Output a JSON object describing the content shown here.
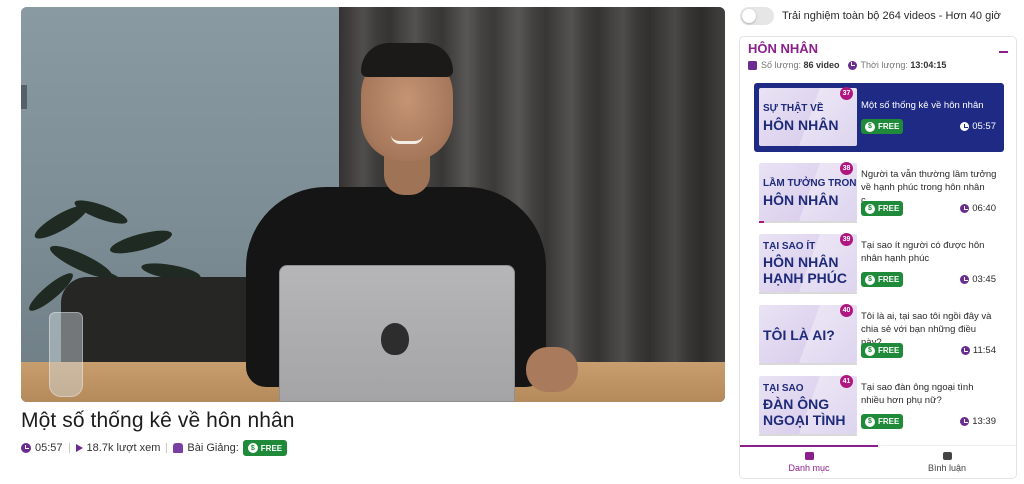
{
  "video": {
    "title": "Một số thống kê về hôn nhân",
    "duration": "05:57",
    "views": "18.7k lượt xem",
    "type_label": "Bài Giảng:",
    "badge": "FREE"
  },
  "trial_toggle": {
    "label": "Trải nghiệm toàn bộ 264 videos - Hơn 40 giờ",
    "enabled": false
  },
  "playlist": {
    "title": "HÔN NHÂN",
    "count_label": "Số lượng:",
    "count_value": "86 video",
    "time_label": "Thời lượng:",
    "time_value": "13:04:15",
    "items": [
      {
        "number": "37",
        "thumb_line1": "SỰ THẬT VỀ",
        "thumb_line2": "HÔN NHÂN",
        "thumb_line3": "",
        "title": "Một số thống kê về hôn nhân",
        "badge": "FREE",
        "duration": "05:57",
        "active": true,
        "progress": 1.0
      },
      {
        "number": "38",
        "thumb_line1": "LẦM TƯỞNG TRONG",
        "thumb_line2": "HÔN NHÂN",
        "thumb_line3": "",
        "title": "Người ta vẫn thường lầm tưởng về hạnh phúc trong hôn nhân c...",
        "badge": "FREE",
        "duration": "06:40",
        "active": false,
        "progress": 0.05
      },
      {
        "number": "39",
        "thumb_line1": "TẠI SAO ÍT",
        "thumb_line2": "HÔN NHÂN",
        "thumb_line3": "HẠNH PHÚC",
        "title": "Tại sao ít người có được hôn nhân hạnh phúc",
        "badge": "FREE",
        "duration": "03:45",
        "active": false,
        "progress": 0
      },
      {
        "number": "40",
        "thumb_line1": "",
        "thumb_line2": "TÔI LÀ AI?",
        "thumb_line3": "",
        "title": "Tôi là ai, tại sao tôi ngồi đây và chia sẻ với bạn những điều này?",
        "badge": "FREE",
        "duration": "11:54",
        "active": false,
        "progress": 0
      },
      {
        "number": "41",
        "thumb_line1": "TẠI SAO",
        "thumb_line2": "ĐÀN ÔNG",
        "thumb_line3": "NGOẠI TÌNH",
        "title": "Tại sao đàn ông ngoại tình nhiều hơn phụ nữ?",
        "badge": "FREE",
        "duration": "13:39",
        "active": false,
        "progress": 0
      }
    ]
  },
  "tabs": [
    {
      "label": "Danh mục",
      "active": true
    },
    {
      "label": "Bình luận",
      "active": false
    }
  ],
  "colors": {
    "brand": "#8c1f8c",
    "active_item": "#1f2a85",
    "free_badge": "#1e8a3a",
    "number_badge": "#b0167f"
  }
}
